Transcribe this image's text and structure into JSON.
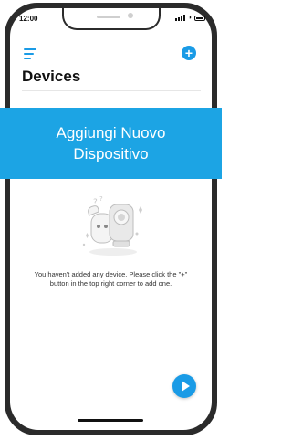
{
  "status_bar": {
    "time": "12:00"
  },
  "header": {
    "title": "Devices",
    "menu_icon": "hamburger-menu-icon",
    "add_icon": "plus-circle-icon"
  },
  "banner": {
    "text": "Aggiungi Nuovo Dispositivo",
    "color": "#1ca4e4"
  },
  "empty_state": {
    "illustration": "camera-mascot-illustration",
    "message": "You haven't added any device. Please click the \"+\" button  in the top right corner to add one."
  },
  "fab": {
    "icon": "play-icon",
    "color": "#1a9be6"
  },
  "colors": {
    "accent": "#1a9be6",
    "frame": "#2b2b2b"
  }
}
